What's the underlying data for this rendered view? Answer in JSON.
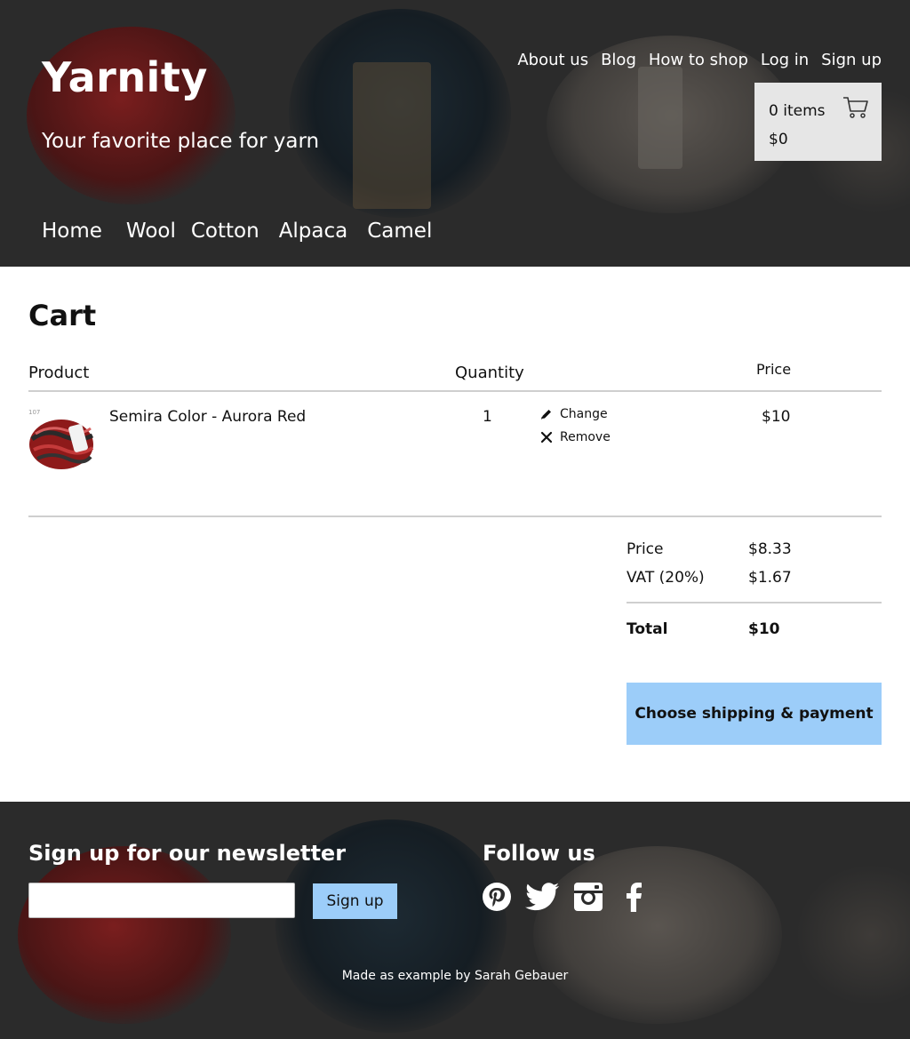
{
  "header": {
    "logo": "Yarnity",
    "tagline": "Your favorite place for yarn",
    "top_nav": [
      "About us",
      "Blog",
      "How to shop",
      "Log in",
      "Sign up"
    ],
    "main_nav": [
      "Home",
      "Wool",
      "Cotton",
      "Alpaca",
      "Camel"
    ],
    "mini_cart": {
      "items": "0 items",
      "total": "$0",
      "icon": "shopping-cart-icon"
    }
  },
  "cart": {
    "title": "Cart",
    "columns": {
      "product": "Product",
      "quantity": "Quantity",
      "price": "Price"
    },
    "items": [
      {
        "name": "Semira Color - Aurora Red",
        "quantity": "1",
        "price": "$10",
        "thumb_number": "107",
        "change_label": "Change",
        "remove_label": "Remove"
      }
    ],
    "summary": {
      "price_label": "Price",
      "price_value": "$8.33",
      "vat_label": "VAT (20%)",
      "vat_value": "$1.67",
      "total_label": "Total",
      "total_value": "$10"
    },
    "checkout_label": "Choose shipping & payment"
  },
  "footer": {
    "newsletter_title": "Sign up for our newsletter",
    "newsletter_placeholder": "",
    "newsletter_button": "Sign up",
    "follow_title": "Follow us",
    "social_icons": [
      "pinterest-icon",
      "twitter-icon",
      "instagram-icon",
      "facebook-icon"
    ],
    "credit": "Made as example by Sarah Gebauer"
  },
  "colors": {
    "header_bg": "#2b2b2b",
    "accent_button": "#9ccdf9",
    "mini_cart_bg": "#e6e6e6",
    "rule": "#cfcfcf"
  }
}
